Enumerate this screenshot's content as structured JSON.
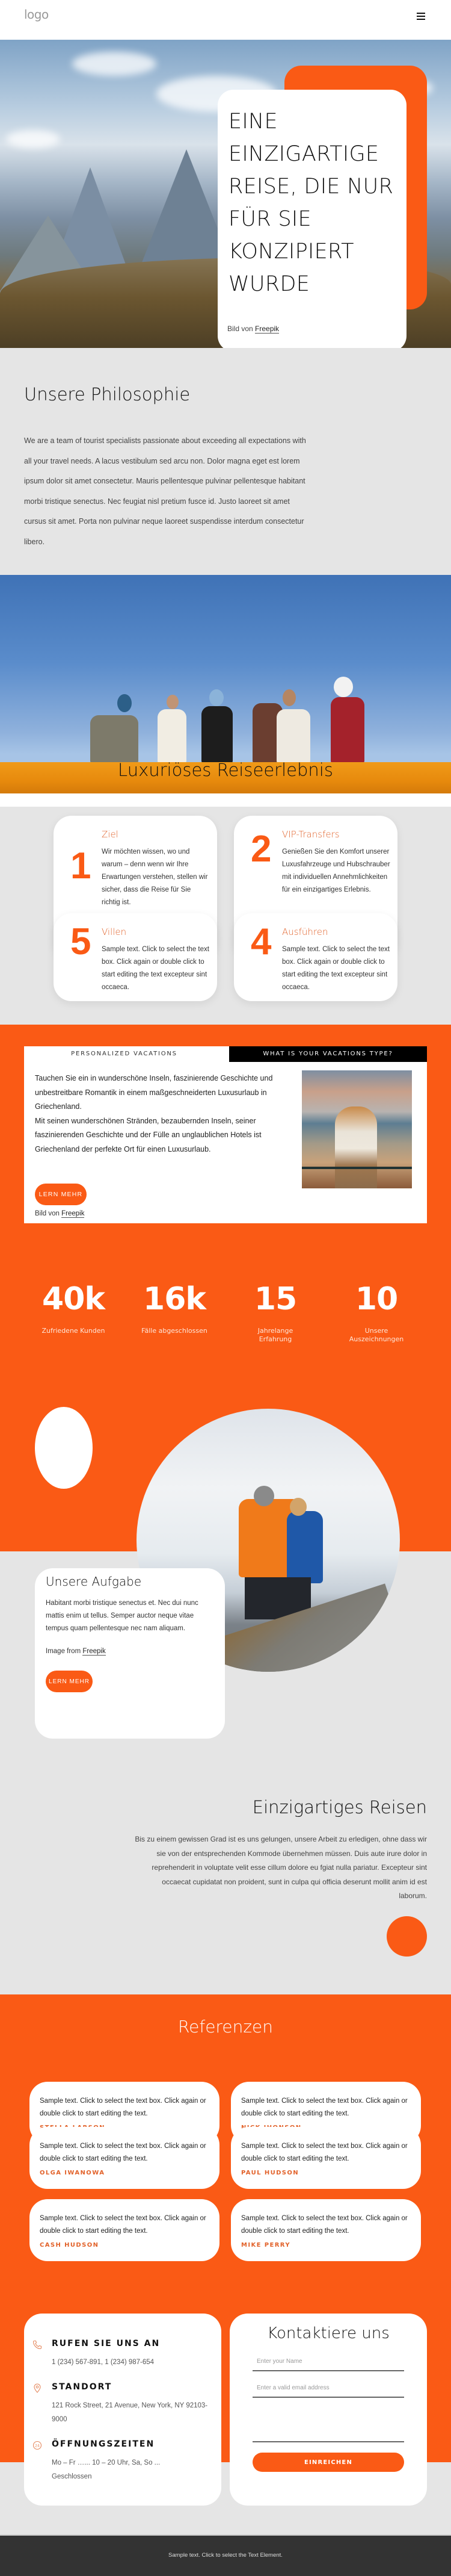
{
  "header": {
    "logo": "logo",
    "menu_icon": "hamburger-menu-icon"
  },
  "hero": {
    "title": "EINE EINZIGARTIGE REISE, DIE NUR FÜR SIE KONZIPIERT WURDE",
    "credit_prefix": "Bild von",
    "credit_link": "Freepik"
  },
  "philosophy": {
    "title": "Unsere Philosophie",
    "text": "We are a team of tourist specialists passionate about exceeding all expectations with all your travel needs. A lacus vestibulum sed arcu non. Dolor magna eget est lorem ipsum dolor sit amet consectetur. Mauris pellentesque pulvinar pellentesque habitant morbi tristique senectus. Nec feugiat nisl pretium fusce id. Justo laoreet sit amet cursus sit amet. Porta non pulvinar neque laoreet suspendisse interdum consectetur libero."
  },
  "luxury": {
    "title": "Luxuriöses Reiseerlebnis",
    "cards": [
      {
        "number": "1",
        "heading": "Ziel",
        "text": "Wir möchten wissen, wo und warum – denn wenn wir Ihre Erwartungen verstehen, stellen wir sicher, dass die Reise für Sie richtig ist."
      },
      {
        "number": "2",
        "heading": "VIP-Transfers",
        "text": "Genießen Sie den Komfort unserer Luxusfahrzeuge und Hubschrauber mit individuellen Annehmlichkeiten für ein einzigartiges Erlebnis."
      },
      {
        "number": "5",
        "heading": "Villen",
        "text": "Sample text. Click to select the text box. Click again or double click to start editing the text excepteur sint occaeca."
      },
      {
        "number": "4",
        "heading": "Ausführen",
        "text": "Sample text. Click to select the text box. Click again or double click to start editing the text excepteur sint occaeca."
      }
    ]
  },
  "tabs": {
    "items": [
      {
        "label": "PERSONALIZED VACATIONS",
        "active": true
      },
      {
        "label": "WHAT IS YOUR VACATIONS TYPE?",
        "active": false
      }
    ],
    "paragraph_1": "Tauchen Sie ein in wunderschöne Inseln, faszinierende Geschichte und unbestreitbare Romantik in einem maßgeschneiderten Luxusurlaub in Griechenland.",
    "paragraph_2": "Mit seinen wunderschönen Stränden, bezaubernden Inseln, seiner faszinierenden Geschichte und der Fülle an unglaublichen Hotels ist Griechenland der perfekte Ort für einen Luxusurlaub.",
    "button": "LERN MEHR",
    "credit_prefix": "Bild von",
    "credit_link": "Freepik"
  },
  "stats": [
    {
      "value": "40k",
      "label": "Zufriedene Kunden"
    },
    {
      "value": "16k",
      "label": "Fälle abgeschlossen"
    },
    {
      "value": "15",
      "label": "Jahrelange Erfahrung"
    },
    {
      "value": "10",
      "label": "Unsere Auszeichnungen"
    }
  ],
  "mission": {
    "title": "Unsere Aufgabe",
    "text": "Habitant morbi tristique senectus et. Nec dui nunc mattis enim ut tellus. Semper auctor neque vitae tempus quam pellentesque nec nam aliquam.",
    "credit_prefix": "Image from",
    "credit_link": "Freepik",
    "button": "LERN MEHR"
  },
  "unique": {
    "title": "Einzigartiges Reisen",
    "text": "Bis zu einem gewissen Grad ist es uns gelungen, unsere Arbeit zu erledigen, ohne dass wir sie von der entsprechenden Kommode übernehmen müssen. Duis aute irure dolor in reprehenderit in voluptate velit esse cillum dolore eu fgiat nulla pariatur. Excepteur sint occaecat cupidatat non proident, sunt in culpa qui officia deserunt mollit anim id est laborum."
  },
  "testimonials": {
    "title": "Referenzen",
    "items": [
      {
        "text": "Sample text. Click to select the text box. Click again or double click to start editing the text.",
        "name": "STELLA LARSON"
      },
      {
        "text": "Sample text. Click to select the text box. Click again or double click to start editing the text.",
        "name": "NICK JHONSON"
      },
      {
        "text": "Sample text. Click to select the text box. Click again or double click to start editing the text.",
        "name": "OLGA IWANOWA"
      },
      {
        "text": "Sample text. Click to select the text box. Click again or double click to start editing the text.",
        "name": "PAUL HUDSON"
      },
      {
        "text": "Sample text. Click to select the text box. Click again or double click to start editing the text.",
        "name": "CASH HUDSON"
      },
      {
        "text": "Sample text. Click to select the text box. Click again or double click to start editing the text.",
        "name": "MIKE PERRY"
      }
    ]
  },
  "contact_info": {
    "call": {
      "icon": "phone-icon",
      "heading": "RUFEN SIE UNS AN",
      "text": "1 (234) 567-891, 1 (234) 987-654"
    },
    "location": {
      "icon": "map-pin-icon",
      "heading": "STANDORT",
      "text": "121 Rock Street, 21 Avenue, New York, NY 92103-9000"
    },
    "hours": {
      "icon": "clock-24-icon",
      "heading": "ÖFFNUNGSZEITEN",
      "text_1": "Mo – Fr …... 10 – 20 Uhr, Sa, So ...",
      "text_2": "Geschlossen"
    }
  },
  "contact_form": {
    "title": "Kontaktiere uns",
    "name_placeholder": "Enter your Name",
    "name_value": "",
    "email_placeholder": "Enter a valid email address",
    "email_value": "",
    "message_value": "",
    "submit": "EINREICHEN"
  },
  "footer": {
    "text": "Sample text. Click to select the Text Element."
  },
  "colors": {
    "accent": "#fa5a15",
    "background": "#e5e5e5",
    "footer": "#333333"
  }
}
